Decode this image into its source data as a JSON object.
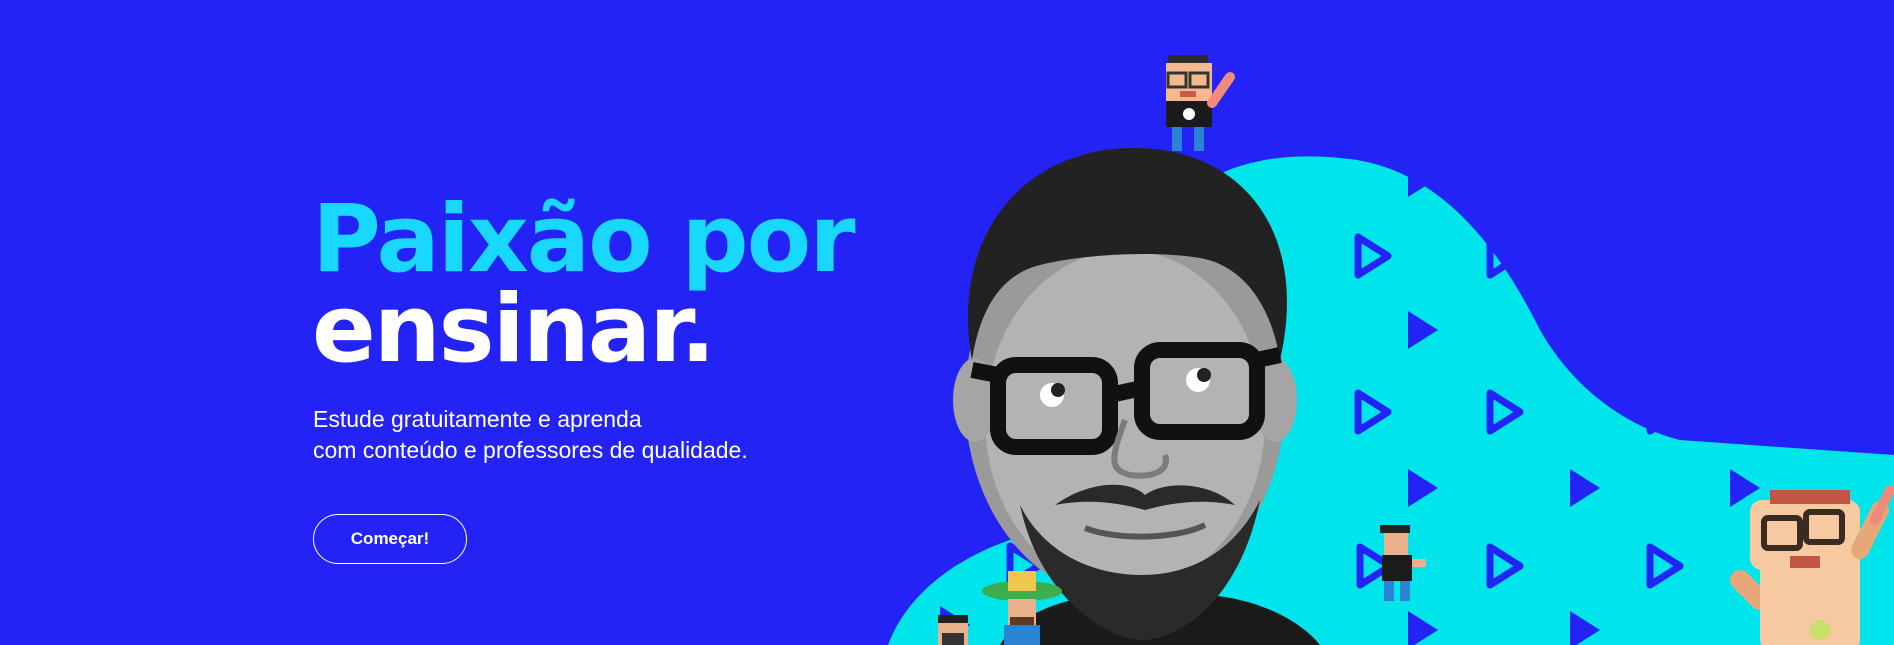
{
  "hero": {
    "headline_line1": "Paixão por",
    "headline_line2": "ensinar.",
    "subtitle_line1": "Estude gratuitamente e aprenda",
    "subtitle_line2": "com conteúdo e professores de qualidade.",
    "cta_label": "Começar!"
  },
  "colors": {
    "background": "#2323f6",
    "accent": "#19d8ff",
    "blob": "#00e5ec"
  },
  "icons": [
    "play-icon",
    "pixel-character-icon"
  ]
}
